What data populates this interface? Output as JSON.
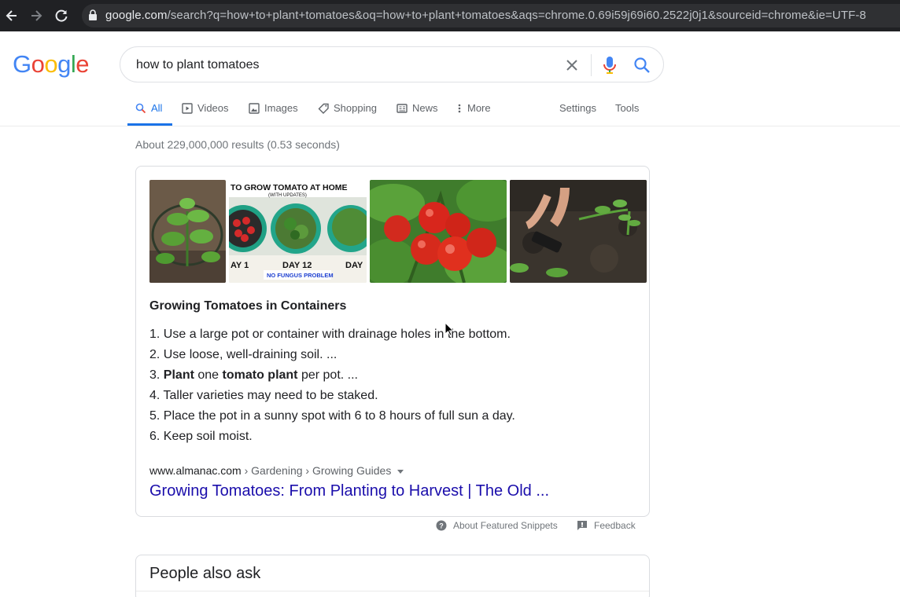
{
  "browser": {
    "url_host": "google.com",
    "url_path": "/search?q=how+to+plant+tomatoes&oq=how+to+plant+tomatoes&aqs=chrome.0.69i59j69i60.2522j0j1&sourceid=chrome&ie=UTF-8"
  },
  "logo": {
    "letters": [
      "G",
      "o",
      "o",
      "g",
      "l",
      "e"
    ],
    "colors": [
      "#4285F4",
      "#EA4335",
      "#FBBC05",
      "#4285F4",
      "#34A853",
      "#EA4335"
    ]
  },
  "search": {
    "query": "how to plant tomatoes"
  },
  "tabs": [
    {
      "label": "All",
      "icon": "search-icon",
      "active": true
    },
    {
      "label": "Videos",
      "icon": "play-icon"
    },
    {
      "label": "Images",
      "icon": "image-icon"
    },
    {
      "label": "Shopping",
      "icon": "tag-icon"
    },
    {
      "label": "News",
      "icon": "news-icon"
    },
    {
      "label": "More",
      "icon": "dots-vertical-icon"
    },
    {
      "label": "Settings"
    },
    {
      "label": "Tools"
    }
  ],
  "stats": "About 229,000,000 results (0.53 seconds)",
  "snippet": {
    "title": "Growing Tomatoes in Containers",
    "items": [
      "1. Use a large pot or container with drainage holes in the bottom.",
      "2. Use loose, well-draining soil. ...",
      "4. Taller varieties may need to be staked.",
      "5. Place the pot in a sunny spot with 6 to 8 hours of full sun a day.",
      "6. Keep soil moist."
    ],
    "item3": {
      "num": "3. ",
      "b1": "Plant",
      "t1": " one ",
      "b2": "tomato plant",
      "t2": " per pot. ..."
    },
    "thumb_texts": {
      "banner": "TO GROW TOMATO AT HOME",
      "sub": "(WITH UPDATES)",
      "day1": "AY 1",
      "day12": "DAY 12",
      "day3": "DAY",
      "fungus": "NO FUNGUS PROBLEM"
    },
    "cite_domain": "www.almanac.com",
    "cite_path": " › Gardening › Growing Guides",
    "link": "Growing Tomatoes: From Planting to Harvest | The Old ..."
  },
  "footer": {
    "about": "About Featured Snippets",
    "feedback": "Feedback"
  },
  "paa": {
    "title": "People also ask"
  }
}
